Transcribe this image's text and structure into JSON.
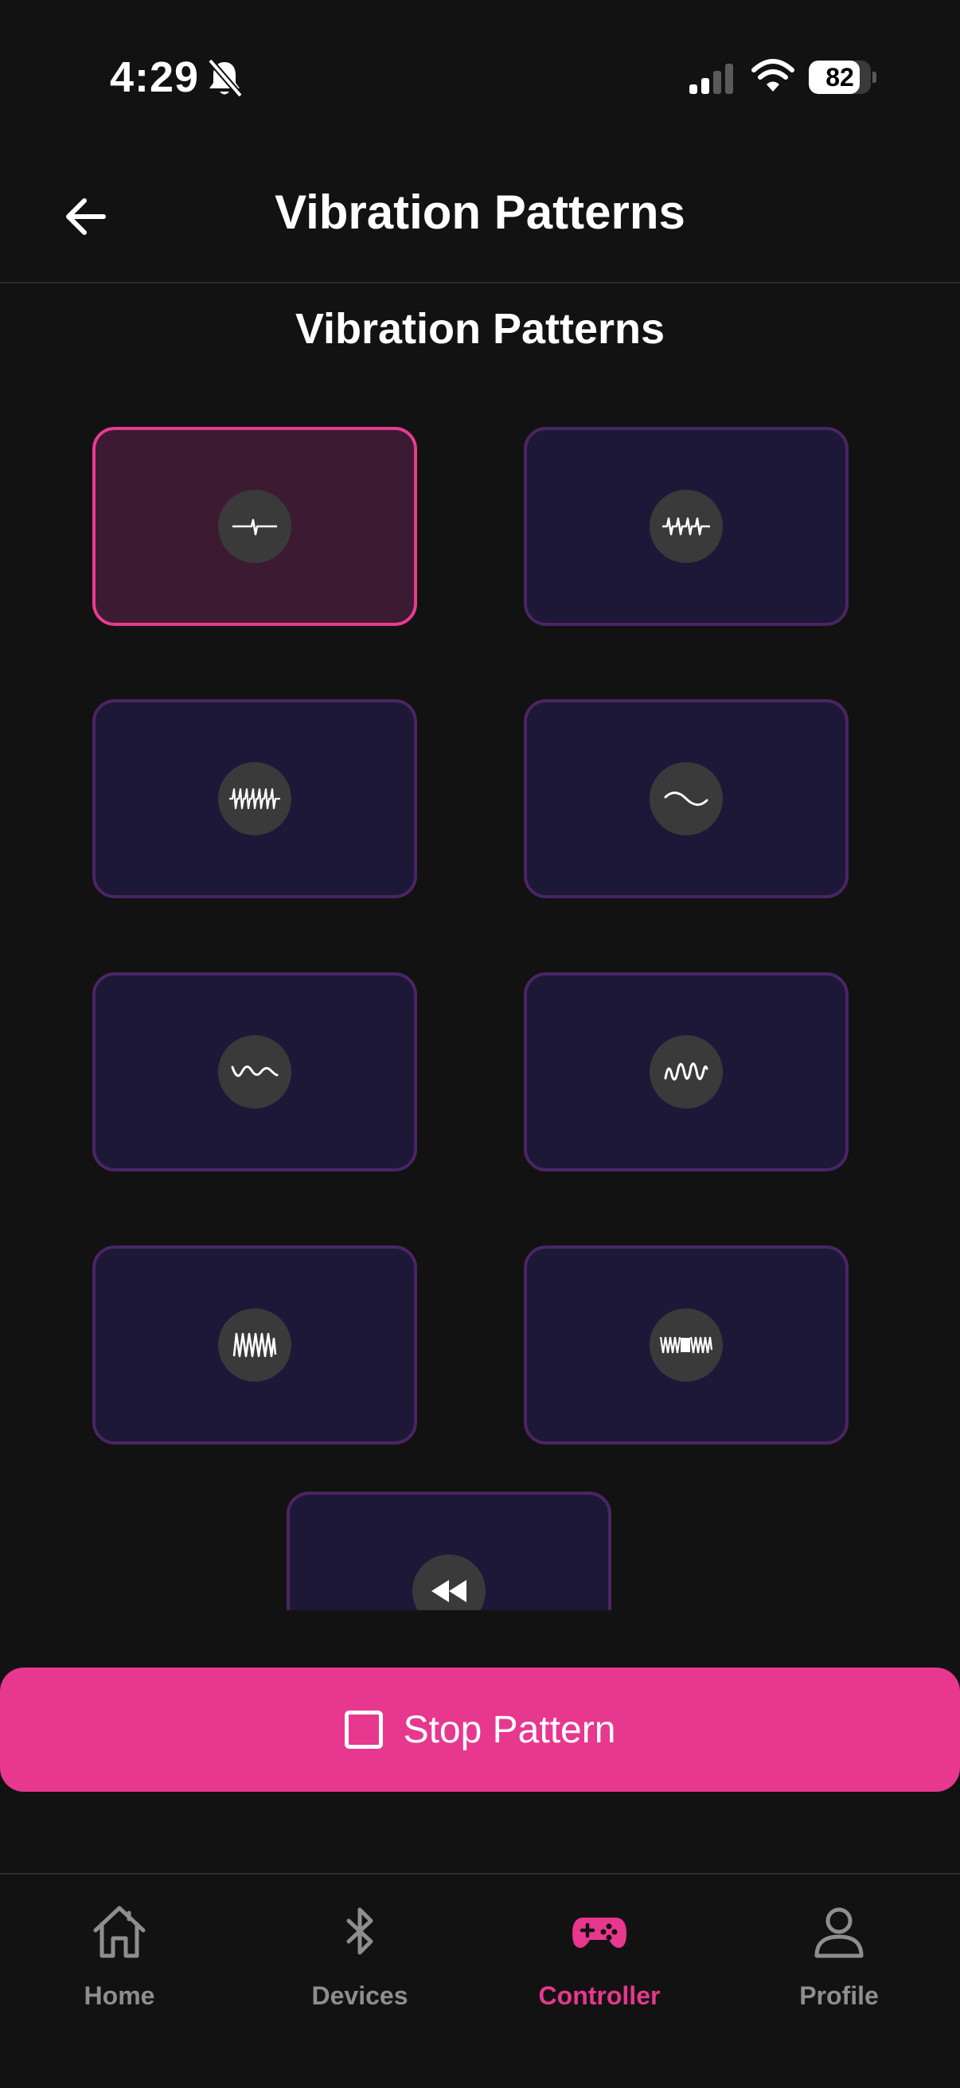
{
  "status_bar": {
    "time": "4:29",
    "battery": 82
  },
  "header": {
    "title": "Vibration Patterns"
  },
  "section": {
    "title": "Vibration Patterns"
  },
  "patterns": [
    {
      "icon": "single-pulse-icon",
      "selected": true
    },
    {
      "icon": "pulse-train-icon",
      "selected": false
    },
    {
      "icon": "dense-pulse-train-icon",
      "selected": false
    },
    {
      "icon": "gentle-wave-icon",
      "selected": false
    },
    {
      "icon": "wave-icon",
      "selected": false
    },
    {
      "icon": "tight-wave-icon",
      "selected": false
    },
    {
      "icon": "dense-wave-icon",
      "selected": false
    },
    {
      "icon": "burst-wave-icon",
      "selected": false
    },
    {
      "icon": "rewind-icon",
      "selected": false
    }
  ],
  "stop_button": {
    "label": "Stop Pattern"
  },
  "nav": {
    "items": [
      {
        "label": "Home",
        "icon": "home-icon"
      },
      {
        "label": "Devices",
        "icon": "bluetooth-icon"
      },
      {
        "label": "Controller",
        "icon": "gamepad-icon"
      },
      {
        "label": "Profile",
        "icon": "profile-icon"
      }
    ],
    "active": "Controller"
  },
  "colors": {
    "accent": "#e8378e",
    "card_bg": "#1d1838",
    "card_border": "#4a2563",
    "selected_bg": "#3c1b32",
    "background": "#121212"
  }
}
